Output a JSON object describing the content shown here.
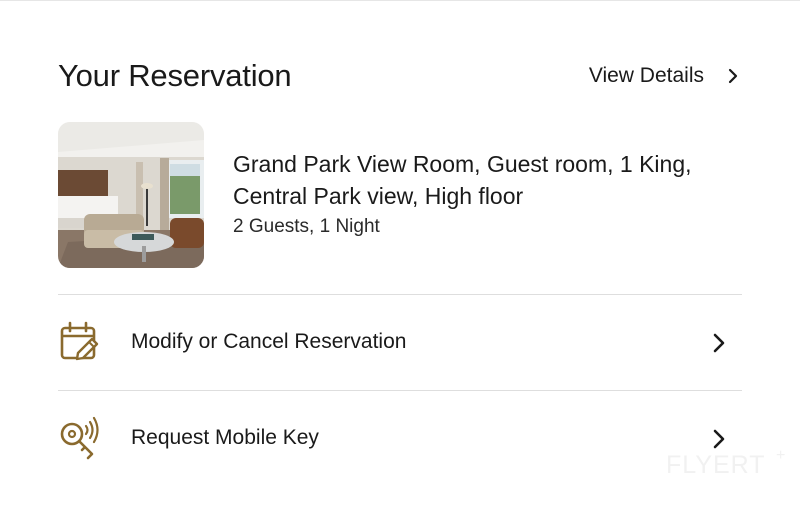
{
  "header": {
    "title": "Your Reservation",
    "view_details_label": "View Details"
  },
  "room": {
    "name": "Grand Park View Room, Guest room, 1 King, Central Park view, High floor",
    "meta": "2 Guests, 1 Night"
  },
  "actions": [
    {
      "label": "Modify or Cancel Reservation",
      "icon": "calendar-edit-icon"
    },
    {
      "label": "Request Mobile Key",
      "icon": "mobile-key-icon"
    }
  ],
  "watermark": {
    "text": "FLYERT",
    "plus": "+"
  },
  "colors": {
    "accent_gold": "#8a6a2e",
    "text": "#1a1a1a",
    "divider": "#dedede"
  }
}
